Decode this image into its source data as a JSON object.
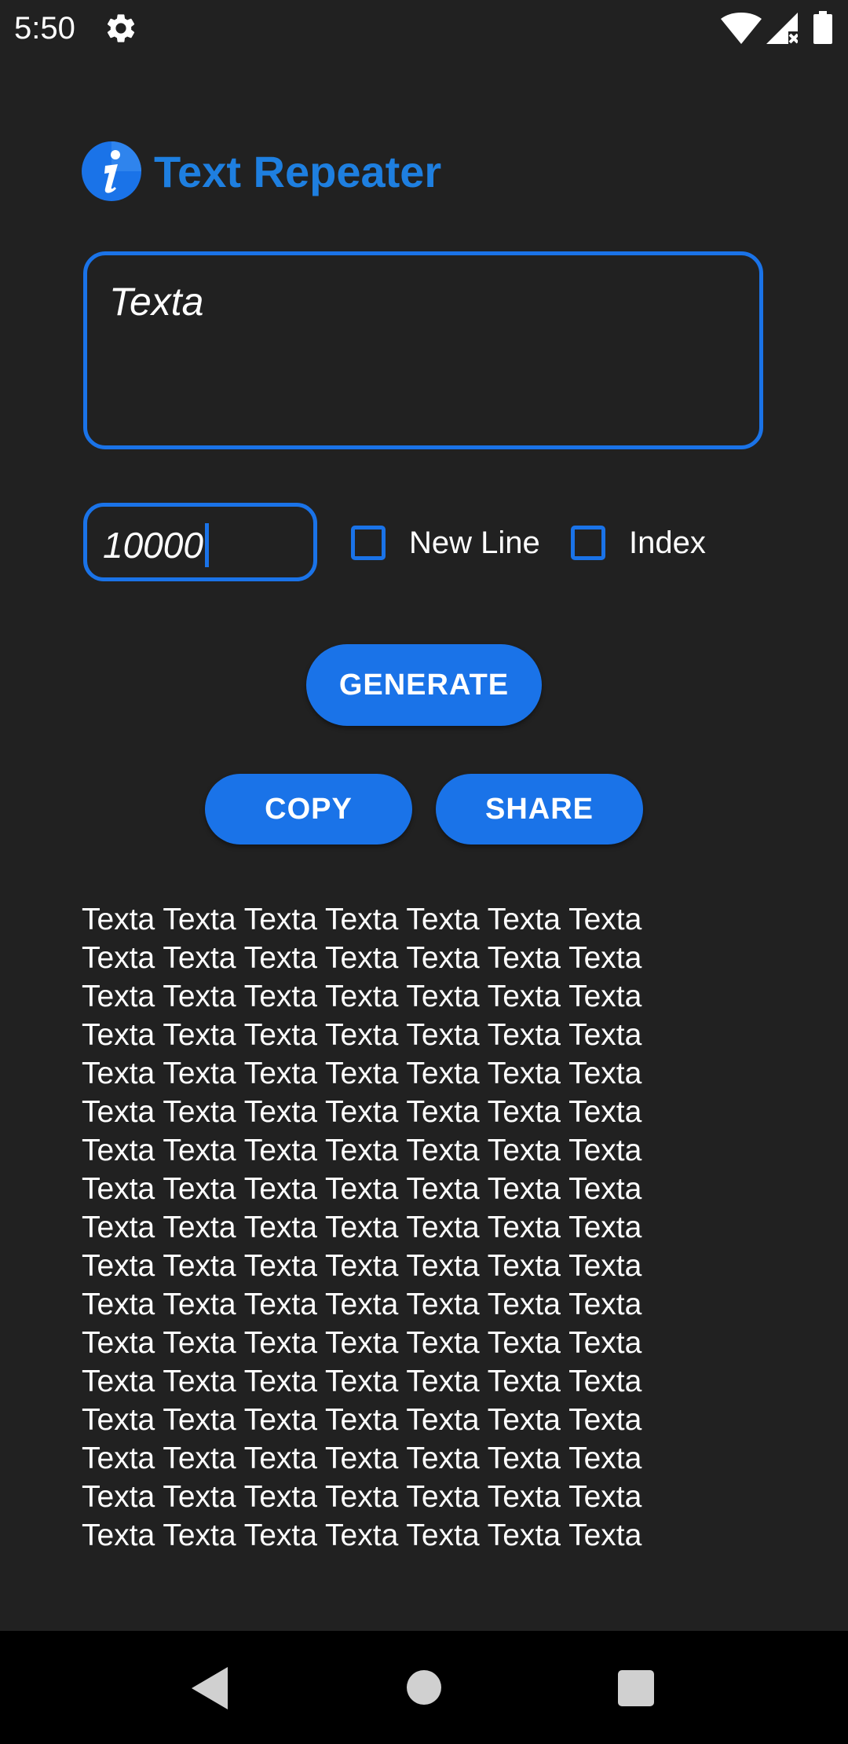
{
  "status_bar": {
    "time": "5:50",
    "icons": [
      "gear-icon",
      "wifi-icon",
      "signal-icon",
      "battery-icon"
    ]
  },
  "header": {
    "title": "Text Repeater",
    "logo_icon": "info-icon"
  },
  "text_input": {
    "value": "Texta"
  },
  "count_input": {
    "value": "10000"
  },
  "options": {
    "new_line_label": "New Line",
    "new_line_checked": false,
    "index_label": "Index",
    "index_checked": false
  },
  "buttons": {
    "generate": "GENERATE",
    "copy": "COPY",
    "share": "SHARE"
  },
  "output": {
    "lines": [
      "Texta Texta Texta Texta Texta Texta Texta",
      "Texta Texta Texta Texta Texta Texta Texta",
      "Texta Texta Texta Texta Texta Texta Texta",
      "Texta Texta Texta Texta Texta Texta Texta",
      "Texta Texta Texta Texta Texta Texta Texta",
      "Texta Texta Texta Texta Texta Texta Texta",
      "Texta Texta Texta Texta Texta Texta Texta",
      "Texta Texta Texta Texta Texta Texta Texta",
      "Texta Texta Texta Texta Texta Texta Texta",
      "Texta Texta Texta Texta Texta Texta Texta",
      "Texta Texta Texta Texta Texta Texta Texta",
      "Texta Texta Texta Texta Texta Texta Texta",
      "Texta Texta Texta Texta Texta Texta Texta",
      "Texta Texta Texta Texta Texta Texta Texta",
      "Texta Texta Texta Texta Texta Texta Texta",
      "Texta Texta Texta Texta Texta Texta Texta",
      "Texta Texta Texta Texta Texta Texta Texta"
    ]
  },
  "nav_bar": {
    "icons": [
      "back-icon",
      "home-icon",
      "recents-icon"
    ]
  },
  "colors": {
    "background": "#212121",
    "accent": "#1a73e8",
    "title": "#1e7fe0",
    "nav_background": "#000000"
  }
}
